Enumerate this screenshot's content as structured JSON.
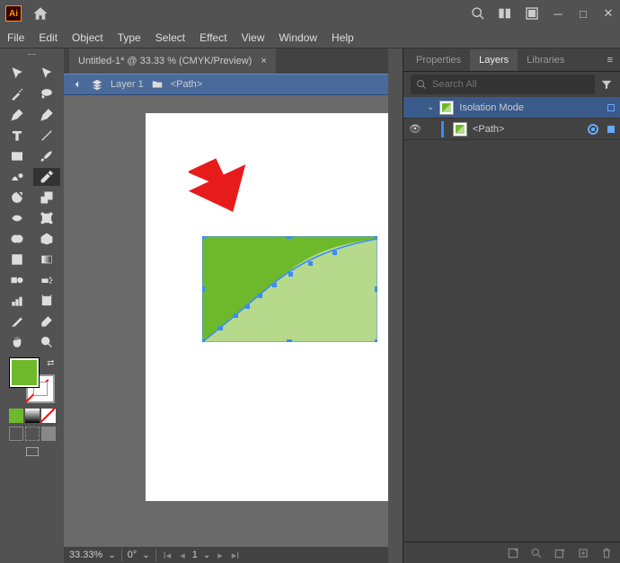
{
  "title_app": "Ai",
  "menus": [
    "File",
    "Edit",
    "Object",
    "Type",
    "Select",
    "Effect",
    "View",
    "Window",
    "Help"
  ],
  "document": {
    "tab_title": "Untitled-1* @ 33.33 % (CMYK/Preview)",
    "close": "×"
  },
  "breadcrumb": {
    "layer": "Layer 1",
    "path": "<Path>"
  },
  "status": {
    "zoom": "33.33%",
    "rotate": "0°",
    "artboard": "1"
  },
  "panels": {
    "tabs": [
      "Properties",
      "Layers",
      "Libraries"
    ],
    "active": 1
  },
  "search": {
    "placeholder": "Search All"
  },
  "layers": {
    "root": {
      "label": "Isolation Mode"
    },
    "child": {
      "label": "<Path>"
    }
  },
  "colors": {
    "fill": "#6eb92b",
    "shape_dark": "#6eb92b",
    "shape_light": "#b6d98c",
    "arrow": "#e81b1b",
    "select": "#3a8cff"
  }
}
